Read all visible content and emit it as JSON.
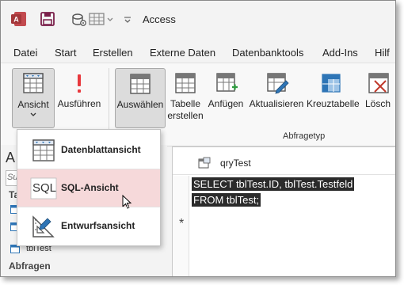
{
  "app": {
    "title": "Access"
  },
  "menu": [
    "Datei",
    "Start",
    "Erstellen",
    "Externe Daten",
    "Datenbanktools",
    "Add-Ins",
    "Hilf"
  ],
  "ribbon": {
    "ansicht": "Ansicht",
    "ausfuehren": "Ausführen",
    "auswaehlen": "Auswählen",
    "tabelle_erstellen_1": "Tabelle",
    "tabelle_erstellen_2": "erstellen",
    "anfuegen": "Anfügen",
    "aktualisieren": "Aktualisieren",
    "kreuztabelle": "Kreuztabelle",
    "loeschen": "Lösch",
    "group_abfragetyp": "Abfragetyp"
  },
  "dropdown": {
    "items": [
      {
        "label": "Datenblattansicht",
        "icon": "datasheet-icon"
      },
      {
        "label": "SQL-Ansicht",
        "icon": "sql-icon",
        "icon_text": "SQL"
      },
      {
        "label": "Entwurfsansicht",
        "icon": "design-view-icon"
      }
    ]
  },
  "nav": {
    "header_letter": "A",
    "search_placeholder": "Such",
    "tables_header": "Ta",
    "items": [
      "tblTest"
    ],
    "queries_header": "Abfragen"
  },
  "document": {
    "tab_title": "qryTest",
    "sql_lines": [
      "SELECT tblTest.ID, tblTest.Testfeld",
      "FROM tblTest;"
    ],
    "row_marker": "*"
  },
  "colors": {
    "access_red": "#a4373a",
    "selection_pink": "#f6d9da",
    "sql_highlight": "#2b2b2b"
  }
}
